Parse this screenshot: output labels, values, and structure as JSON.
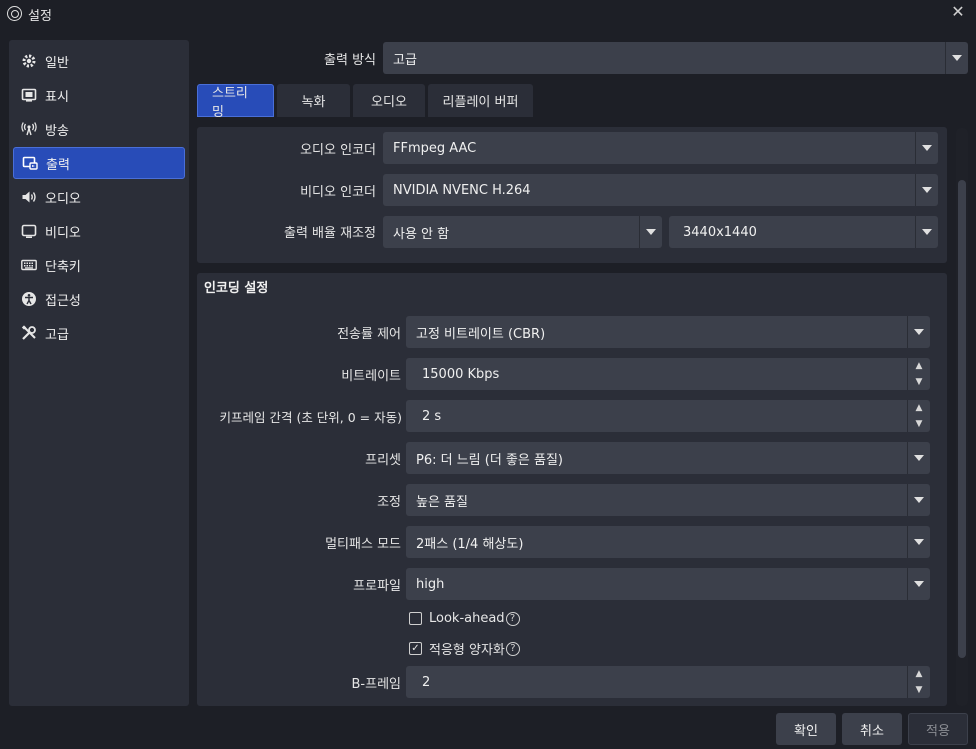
{
  "window": {
    "title": "설정",
    "close_glyph": "✕"
  },
  "sidebar": {
    "items": [
      {
        "label": "일반",
        "icon": "gear-icon"
      },
      {
        "label": "표시",
        "icon": "display-icon"
      },
      {
        "label": "방송",
        "icon": "broadcast-icon"
      },
      {
        "label": "출력",
        "icon": "output-icon",
        "active": true
      },
      {
        "label": "오디오",
        "icon": "speaker-icon"
      },
      {
        "label": "비디오",
        "icon": "monitor-icon"
      },
      {
        "label": "단축키",
        "icon": "keyboard-icon"
      },
      {
        "label": "접근성",
        "icon": "accessibility-icon"
      },
      {
        "label": "고급",
        "icon": "tools-icon"
      }
    ]
  },
  "output_mode": {
    "label": "출력 방식",
    "value": "고급"
  },
  "tabs": [
    {
      "label": "스트리밍",
      "active": true
    },
    {
      "label": "녹화"
    },
    {
      "label": "오디오"
    },
    {
      "label": "리플레이 버퍼"
    }
  ],
  "top_panel": {
    "audio_encoder": {
      "label": "오디오 인코더",
      "value": "FFmpeg AAC"
    },
    "video_encoder": {
      "label": "비디오 인코더",
      "value": "NVIDIA NVENC H.264"
    },
    "rescale": {
      "label": "출력 배율 재조정",
      "value": "사용 안 함",
      "resolution": "3440x1440"
    }
  },
  "encoder_settings": {
    "title": "인코딩 설정",
    "rate_control": {
      "label": "전송률 제어",
      "value": "고정 비트레이트 (CBR)"
    },
    "bitrate": {
      "label": "비트레이트",
      "value": "15000 Kbps"
    },
    "keyframe": {
      "label": "키프레임 간격 (초 단위, 0 = 자동)",
      "value": "2 s"
    },
    "preset": {
      "label": "프리셋",
      "value": "P6: 더 느림 (더 좋은 품질)"
    },
    "tuning": {
      "label": "조정",
      "value": "높은 품질"
    },
    "multipass": {
      "label": "멀티패스 모드",
      "value": "2패스 (1/4 해상도)"
    },
    "profile": {
      "label": "프로파일",
      "value": "high"
    },
    "lookahead": {
      "label": "Look-ahead",
      "checked": false
    },
    "adaptive_quant": {
      "label": "적응형 양자화",
      "checked": true
    },
    "bframes": {
      "label": "B-프레임",
      "value": "2"
    }
  },
  "buttons": {
    "ok": "확인",
    "cancel": "취소",
    "apply": "적용"
  },
  "colors": {
    "accent": "#284cb8",
    "background": "#1d1f26",
    "panel": "#2b2e38",
    "input": "#3c404b"
  }
}
